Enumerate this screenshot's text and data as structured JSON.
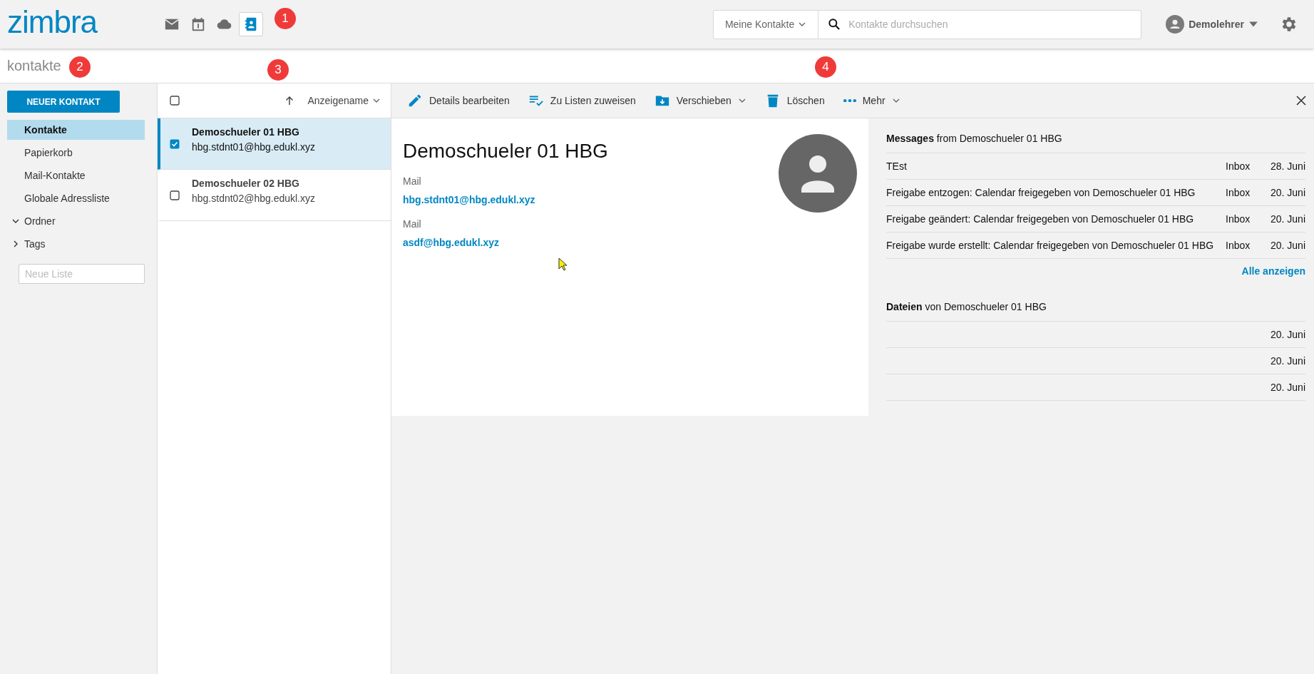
{
  "header": {
    "logo": "zimbra",
    "apps": [
      {
        "kind": "mail",
        "selected": false
      },
      {
        "kind": "calendar",
        "selected": false
      },
      {
        "kind": "cloud",
        "selected": false
      },
      {
        "kind": "contacts",
        "selected": true
      }
    ],
    "search": {
      "scope": "Meine Kontakte",
      "placeholder": "Kontakte durchsuchen"
    },
    "user": "Demolehrer"
  },
  "page_title": "kontakte",
  "markers": [
    "1",
    "2",
    "3",
    "4"
  ],
  "sidebar": {
    "new_button": "NEUER KONTAKT",
    "items": [
      {
        "label": "Kontakte",
        "selected": true
      },
      {
        "label": "Papierkorb",
        "selected": false
      },
      {
        "label": "Mail-Kontakte",
        "selected": false
      },
      {
        "label": "Globale Adressliste",
        "selected": false
      }
    ],
    "groups": [
      {
        "label": "Ordner",
        "expanded": true
      },
      {
        "label": "Tags",
        "expanded": false
      }
    ],
    "new_list": {
      "placeholder": "Neue Liste"
    }
  },
  "contact_list": {
    "select_all": false,
    "sort_label": "Anzeigename",
    "rows": [
      {
        "name": "Demoschueler 01 HBG",
        "email": "hbg.stdnt01@hbg.edukl.xyz",
        "selected": true,
        "checked": true
      },
      {
        "name": "Demoschueler 02 HBG",
        "email": "hbg.stdnt02@hbg.edukl.xyz",
        "selected": false,
        "checked": false
      }
    ]
  },
  "toolbar": {
    "actions": [
      {
        "kind": "edit",
        "label": "Details bearbeiten",
        "dropdown": false
      },
      {
        "kind": "assign",
        "label": "Zu Listen zuweisen",
        "dropdown": false
      },
      {
        "kind": "move",
        "label": "Verschieben",
        "dropdown": true
      },
      {
        "kind": "delete",
        "label": "Löschen",
        "dropdown": false
      },
      {
        "kind": "more",
        "label": "Mehr",
        "dropdown": true
      }
    ]
  },
  "contact": {
    "name": "Demoschueler 01 HBG",
    "fields": [
      {
        "label": "Mail",
        "value": "hbg.stdnt01@hbg.edukl.xyz"
      },
      {
        "label": "Mail",
        "value": "asdf@hbg.edukl.xyz"
      }
    ]
  },
  "messages": {
    "title": "**Messages** from Demoschueler 01 HBG",
    "rows": [
      {
        "subject": "TEst",
        "folder": "Inbox",
        "date": "28. Juni"
      },
      {
        "subject": "Freigabe entzogen: Calendar freigegeben von Demoschueler 01 HBG",
        "folder": "Inbox",
        "date": "20. Juni"
      },
      {
        "subject": "Freigabe geändert: Calendar freigegeben von Demoschueler 01 HBG",
        "folder": "Inbox",
        "date": "20. Juni"
      },
      {
        "subject": "Freigabe wurde erstellt: Calendar freigegeben von Demoschueler 01 HBG",
        "folder": "Inbox",
        "date": "20. Juni"
      }
    ],
    "show_all": "Alle anzeigen"
  },
  "files": {
    "title": "**Dateien** von Demoschueler 01 HBG",
    "rows": [
      {
        "date": "20. Juni"
      },
      {
        "date": "20. Juni"
      },
      {
        "date": "20. Juni"
      }
    ]
  }
}
